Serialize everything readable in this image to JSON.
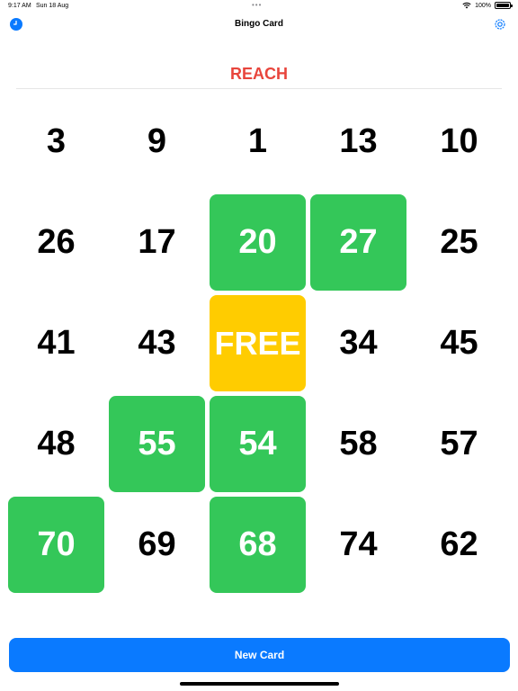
{
  "status_bar": {
    "time": "9:17 AM",
    "date": "Sun 18 Aug",
    "dots": "•••",
    "battery": "100%"
  },
  "nav": {
    "title": "Bingo Card",
    "left_icon": "clock-icon",
    "right_icon": "gear-icon"
  },
  "card_status": "REACH",
  "colors": {
    "marked": "#34c759",
    "free": "#ffcc00",
    "accent": "#0a7aff",
    "status": "#e8453c"
  },
  "grid": [
    [
      {
        "label": "3",
        "state": "unmarked"
      },
      {
        "label": "9",
        "state": "unmarked"
      },
      {
        "label": "1",
        "state": "unmarked"
      },
      {
        "label": "13",
        "state": "unmarked"
      },
      {
        "label": "10",
        "state": "unmarked"
      }
    ],
    [
      {
        "label": "26",
        "state": "unmarked"
      },
      {
        "label": "17",
        "state": "unmarked"
      },
      {
        "label": "20",
        "state": "marked"
      },
      {
        "label": "27",
        "state": "marked"
      },
      {
        "label": "25",
        "state": "unmarked"
      }
    ],
    [
      {
        "label": "41",
        "state": "unmarked"
      },
      {
        "label": "43",
        "state": "unmarked"
      },
      {
        "label": "FREE",
        "state": "free"
      },
      {
        "label": "34",
        "state": "unmarked"
      },
      {
        "label": "45",
        "state": "unmarked"
      }
    ],
    [
      {
        "label": "48",
        "state": "unmarked"
      },
      {
        "label": "55",
        "state": "marked"
      },
      {
        "label": "54",
        "state": "marked"
      },
      {
        "label": "58",
        "state": "unmarked"
      },
      {
        "label": "57",
        "state": "unmarked"
      }
    ],
    [
      {
        "label": "70",
        "state": "marked"
      },
      {
        "label": "69",
        "state": "unmarked"
      },
      {
        "label": "68",
        "state": "marked"
      },
      {
        "label": "74",
        "state": "unmarked"
      },
      {
        "label": "62",
        "state": "unmarked"
      }
    ]
  ],
  "new_card_label": "New Card"
}
